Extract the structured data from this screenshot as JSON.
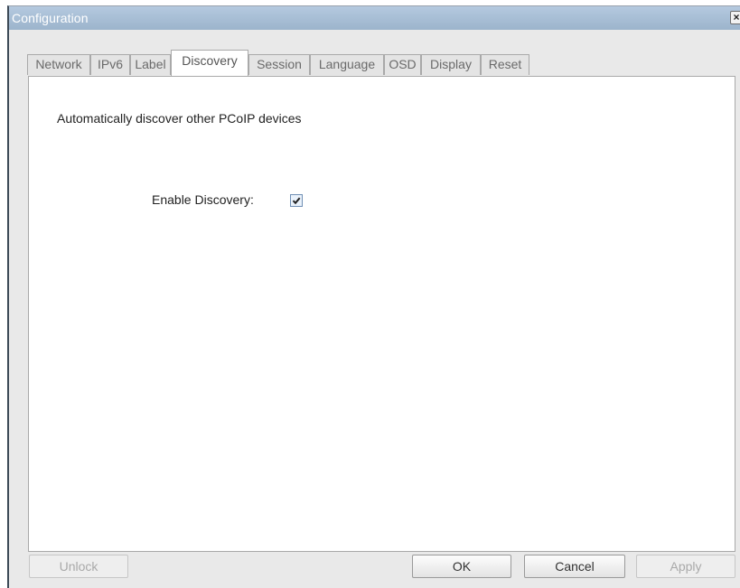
{
  "window": {
    "title": "Configuration",
    "close_glyph": "×"
  },
  "tabs": [
    {
      "label": "Network",
      "active": false
    },
    {
      "label": "IPv6",
      "active": false
    },
    {
      "label": "Label",
      "active": false
    },
    {
      "label": "Discovery",
      "active": true
    },
    {
      "label": "Session",
      "active": false
    },
    {
      "label": "Language",
      "active": false
    },
    {
      "label": "OSD",
      "active": false
    },
    {
      "label": "Display",
      "active": false
    },
    {
      "label": "Reset",
      "active": false
    }
  ],
  "discovery": {
    "description": "Automatically discover other PCoIP devices",
    "enable_label": "Enable Discovery:",
    "enabled": true
  },
  "buttons": {
    "unlock": {
      "label": "Unlock",
      "disabled": true
    },
    "ok": {
      "label": "OK",
      "disabled": false
    },
    "cancel": {
      "label": "Cancel",
      "disabled": false
    },
    "apply": {
      "label": "Apply",
      "disabled": true
    }
  },
  "colors": {
    "titlebar": "#a8bfd6",
    "window_bg": "#e9e9e9",
    "checkbox_border": "#6f8fb5"
  }
}
